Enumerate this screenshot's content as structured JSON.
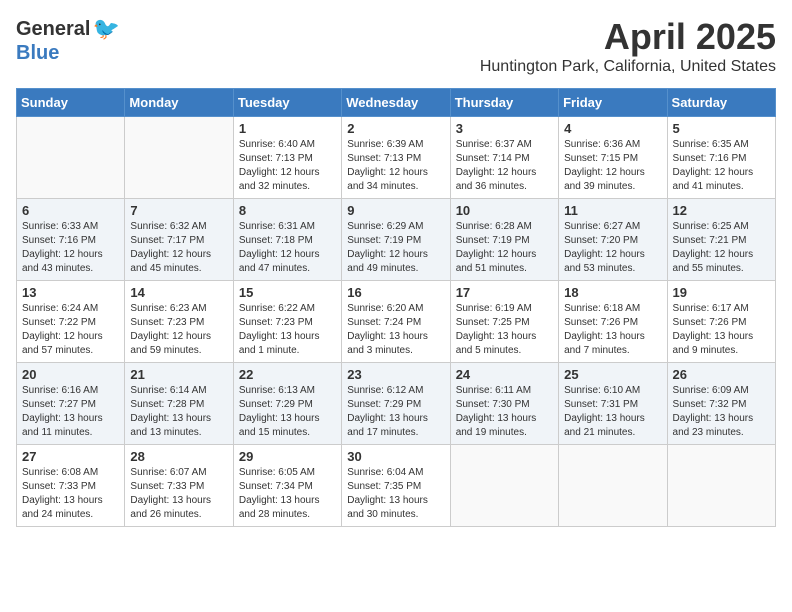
{
  "header": {
    "logo_general": "General",
    "logo_blue": "Blue",
    "month_title": "April 2025",
    "location": "Huntington Park, California, United States"
  },
  "days_of_week": [
    "Sunday",
    "Monday",
    "Tuesday",
    "Wednesday",
    "Thursday",
    "Friday",
    "Saturday"
  ],
  "weeks": [
    {
      "days": [
        {
          "num": "",
          "sunrise": "",
          "sunset": "",
          "daylight": "",
          "empty": true
        },
        {
          "num": "",
          "sunrise": "",
          "sunset": "",
          "daylight": "",
          "empty": true
        },
        {
          "num": "1",
          "sunrise": "Sunrise: 6:40 AM",
          "sunset": "Sunset: 7:13 PM",
          "daylight": "Daylight: 12 hours and 32 minutes.",
          "empty": false
        },
        {
          "num": "2",
          "sunrise": "Sunrise: 6:39 AM",
          "sunset": "Sunset: 7:13 PM",
          "daylight": "Daylight: 12 hours and 34 minutes.",
          "empty": false
        },
        {
          "num": "3",
          "sunrise": "Sunrise: 6:37 AM",
          "sunset": "Sunset: 7:14 PM",
          "daylight": "Daylight: 12 hours and 36 minutes.",
          "empty": false
        },
        {
          "num": "4",
          "sunrise": "Sunrise: 6:36 AM",
          "sunset": "Sunset: 7:15 PM",
          "daylight": "Daylight: 12 hours and 39 minutes.",
          "empty": false
        },
        {
          "num": "5",
          "sunrise": "Sunrise: 6:35 AM",
          "sunset": "Sunset: 7:16 PM",
          "daylight": "Daylight: 12 hours and 41 minutes.",
          "empty": false
        }
      ]
    },
    {
      "days": [
        {
          "num": "6",
          "sunrise": "Sunrise: 6:33 AM",
          "sunset": "Sunset: 7:16 PM",
          "daylight": "Daylight: 12 hours and 43 minutes.",
          "empty": false
        },
        {
          "num": "7",
          "sunrise": "Sunrise: 6:32 AM",
          "sunset": "Sunset: 7:17 PM",
          "daylight": "Daylight: 12 hours and 45 minutes.",
          "empty": false
        },
        {
          "num": "8",
          "sunrise": "Sunrise: 6:31 AM",
          "sunset": "Sunset: 7:18 PM",
          "daylight": "Daylight: 12 hours and 47 minutes.",
          "empty": false
        },
        {
          "num": "9",
          "sunrise": "Sunrise: 6:29 AM",
          "sunset": "Sunset: 7:19 PM",
          "daylight": "Daylight: 12 hours and 49 minutes.",
          "empty": false
        },
        {
          "num": "10",
          "sunrise": "Sunrise: 6:28 AM",
          "sunset": "Sunset: 7:19 PM",
          "daylight": "Daylight: 12 hours and 51 minutes.",
          "empty": false
        },
        {
          "num": "11",
          "sunrise": "Sunrise: 6:27 AM",
          "sunset": "Sunset: 7:20 PM",
          "daylight": "Daylight: 12 hours and 53 minutes.",
          "empty": false
        },
        {
          "num": "12",
          "sunrise": "Sunrise: 6:25 AM",
          "sunset": "Sunset: 7:21 PM",
          "daylight": "Daylight: 12 hours and 55 minutes.",
          "empty": false
        }
      ]
    },
    {
      "days": [
        {
          "num": "13",
          "sunrise": "Sunrise: 6:24 AM",
          "sunset": "Sunset: 7:22 PM",
          "daylight": "Daylight: 12 hours and 57 minutes.",
          "empty": false
        },
        {
          "num": "14",
          "sunrise": "Sunrise: 6:23 AM",
          "sunset": "Sunset: 7:23 PM",
          "daylight": "Daylight: 12 hours and 59 minutes.",
          "empty": false
        },
        {
          "num": "15",
          "sunrise": "Sunrise: 6:22 AM",
          "sunset": "Sunset: 7:23 PM",
          "daylight": "Daylight: 13 hours and 1 minute.",
          "empty": false
        },
        {
          "num": "16",
          "sunrise": "Sunrise: 6:20 AM",
          "sunset": "Sunset: 7:24 PM",
          "daylight": "Daylight: 13 hours and 3 minutes.",
          "empty": false
        },
        {
          "num": "17",
          "sunrise": "Sunrise: 6:19 AM",
          "sunset": "Sunset: 7:25 PM",
          "daylight": "Daylight: 13 hours and 5 minutes.",
          "empty": false
        },
        {
          "num": "18",
          "sunrise": "Sunrise: 6:18 AM",
          "sunset": "Sunset: 7:26 PM",
          "daylight": "Daylight: 13 hours and 7 minutes.",
          "empty": false
        },
        {
          "num": "19",
          "sunrise": "Sunrise: 6:17 AM",
          "sunset": "Sunset: 7:26 PM",
          "daylight": "Daylight: 13 hours and 9 minutes.",
          "empty": false
        }
      ]
    },
    {
      "days": [
        {
          "num": "20",
          "sunrise": "Sunrise: 6:16 AM",
          "sunset": "Sunset: 7:27 PM",
          "daylight": "Daylight: 13 hours and 11 minutes.",
          "empty": false
        },
        {
          "num": "21",
          "sunrise": "Sunrise: 6:14 AM",
          "sunset": "Sunset: 7:28 PM",
          "daylight": "Daylight: 13 hours and 13 minutes.",
          "empty": false
        },
        {
          "num": "22",
          "sunrise": "Sunrise: 6:13 AM",
          "sunset": "Sunset: 7:29 PM",
          "daylight": "Daylight: 13 hours and 15 minutes.",
          "empty": false
        },
        {
          "num": "23",
          "sunrise": "Sunrise: 6:12 AM",
          "sunset": "Sunset: 7:29 PM",
          "daylight": "Daylight: 13 hours and 17 minutes.",
          "empty": false
        },
        {
          "num": "24",
          "sunrise": "Sunrise: 6:11 AM",
          "sunset": "Sunset: 7:30 PM",
          "daylight": "Daylight: 13 hours and 19 minutes.",
          "empty": false
        },
        {
          "num": "25",
          "sunrise": "Sunrise: 6:10 AM",
          "sunset": "Sunset: 7:31 PM",
          "daylight": "Daylight: 13 hours and 21 minutes.",
          "empty": false
        },
        {
          "num": "26",
          "sunrise": "Sunrise: 6:09 AM",
          "sunset": "Sunset: 7:32 PM",
          "daylight": "Daylight: 13 hours and 23 minutes.",
          "empty": false
        }
      ]
    },
    {
      "days": [
        {
          "num": "27",
          "sunrise": "Sunrise: 6:08 AM",
          "sunset": "Sunset: 7:33 PM",
          "daylight": "Daylight: 13 hours and 24 minutes.",
          "empty": false
        },
        {
          "num": "28",
          "sunrise": "Sunrise: 6:07 AM",
          "sunset": "Sunset: 7:33 PM",
          "daylight": "Daylight: 13 hours and 26 minutes.",
          "empty": false
        },
        {
          "num": "29",
          "sunrise": "Sunrise: 6:05 AM",
          "sunset": "Sunset: 7:34 PM",
          "daylight": "Daylight: 13 hours and 28 minutes.",
          "empty": false
        },
        {
          "num": "30",
          "sunrise": "Sunrise: 6:04 AM",
          "sunset": "Sunset: 7:35 PM",
          "daylight": "Daylight: 13 hours and 30 minutes.",
          "empty": false
        },
        {
          "num": "",
          "sunrise": "",
          "sunset": "",
          "daylight": "",
          "empty": true
        },
        {
          "num": "",
          "sunrise": "",
          "sunset": "",
          "daylight": "",
          "empty": true
        },
        {
          "num": "",
          "sunrise": "",
          "sunset": "",
          "daylight": "",
          "empty": true
        }
      ]
    }
  ]
}
